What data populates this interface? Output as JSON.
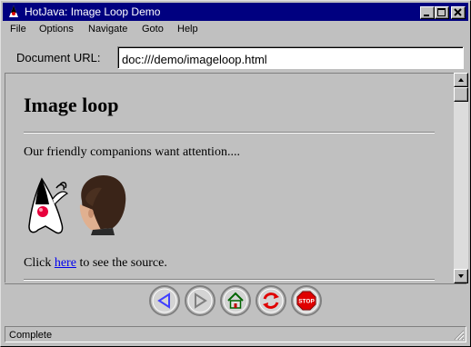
{
  "window": {
    "title": "HotJava: Image Loop Demo"
  },
  "menu": {
    "items": [
      "File",
      "Options",
      "Navigate",
      "Goto",
      "Help"
    ]
  },
  "location": {
    "label": "Document URL:",
    "value": "doc:///demo/imageloop.html"
  },
  "document": {
    "heading": "Image loop",
    "intro": "Our friendly companions want attention....",
    "click_prefix": "Click ",
    "link_text": "here",
    "click_suffix": " to see the source."
  },
  "toolbar": {
    "buttons": [
      {
        "icon": "back-arrow-icon",
        "color": "#4040ff"
      },
      {
        "icon": "forward-arrow-icon",
        "color": "#808080"
      },
      {
        "icon": "home-icon",
        "color": "#006400"
      },
      {
        "icon": "reload-icon",
        "color": "#e00000"
      },
      {
        "icon": "stop-icon",
        "color": "#e00000",
        "text": "STOP"
      }
    ]
  },
  "status": {
    "text": "Complete"
  },
  "colors": {
    "titlebar": "#000080",
    "link": "#0000ee",
    "face": "#c0c0c0"
  }
}
